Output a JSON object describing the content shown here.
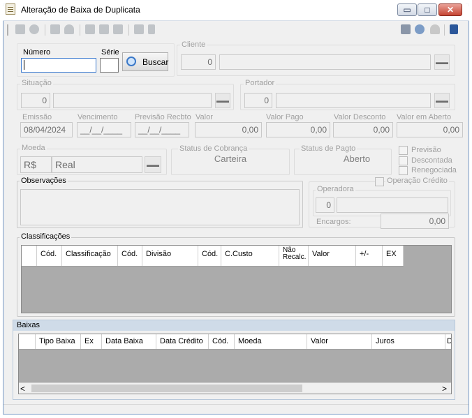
{
  "window": {
    "title": "Alteração de Baixa de Duplicata",
    "controls": {
      "minimize": "▭",
      "maximize": "□",
      "close": "✕"
    }
  },
  "toolbar": {
    "left_icons": [
      "new-icon",
      "cancel-icon",
      "save-icon",
      "undo-icon",
      "search-icon",
      "filter-icon",
      "print-icon",
      "report-icon",
      "delete-icon"
    ],
    "right_icons": [
      "calculator-icon",
      "settings-icon",
      "user-icon",
      "menu-icon"
    ]
  },
  "form": {
    "numero_label": "Número",
    "numero_value": "",
    "serie_label": "Série",
    "serie_value": "",
    "buscar_label": "Buscar",
    "cliente_label": "Cliente",
    "cliente_code": "0",
    "cliente_name": "",
    "situacao_label": "Situação",
    "situacao_code": "0",
    "situacao_name": "",
    "portador_label": "Portador",
    "portador_code": "0",
    "portador_name": "",
    "emissao_label": "Emissão",
    "emissao_value": "08/04/2024",
    "vencimento_label": "Vencimento",
    "vencimento_value": "__/__/____",
    "previsao_label": "Previsão Recbto",
    "previsao_value": "__/__/____",
    "valor_label": "Valor",
    "valor_value": "0,00",
    "valor_pago_label": "Valor Pago",
    "valor_pago_value": "0,00",
    "valor_desconto_label": "Valor Desconto",
    "valor_desconto_value": "0,00",
    "valor_aberto_label": "Valor em Aberto",
    "valor_aberto_value": "0,00",
    "moeda_label": "Moeda",
    "moeda_symbol": "R$",
    "moeda_name": "Real",
    "status_cobranca_label": "Status de Cobrança",
    "status_cobranca_value": "Carteira",
    "status_pagto_label": "Status de Pagto",
    "status_pagto_value": "Aberto",
    "chk_previsao": "Previsão",
    "chk_descontada": "Descontada",
    "chk_renegociada": "Renegociada",
    "observacoes_label": "Observações",
    "operacao_credito_label": "Operação Crédito",
    "operadora_label": "Operadora",
    "operadora_code": "0",
    "operadora_name": "",
    "encargos_label": "Encargos:",
    "encargos_value": "0,00"
  },
  "classificacoes": {
    "title": "Classificações",
    "columns": [
      "Cód.",
      "Classificação",
      "Cód.",
      "Divisão",
      "Cód.",
      "C.Custo",
      "Não Recalc.",
      "Valor",
      "+/-",
      "EX"
    ],
    "rows": []
  },
  "baixas": {
    "title": "Baixas",
    "columns": [
      "Tipo Baixa",
      "Ex",
      "Data Baixa",
      "Data Crédito",
      "Cód.",
      "Moeda",
      "Valor",
      "Juros",
      "D"
    ],
    "rows": []
  },
  "scrollbar": {
    "left": "<",
    "right": ">"
  }
}
